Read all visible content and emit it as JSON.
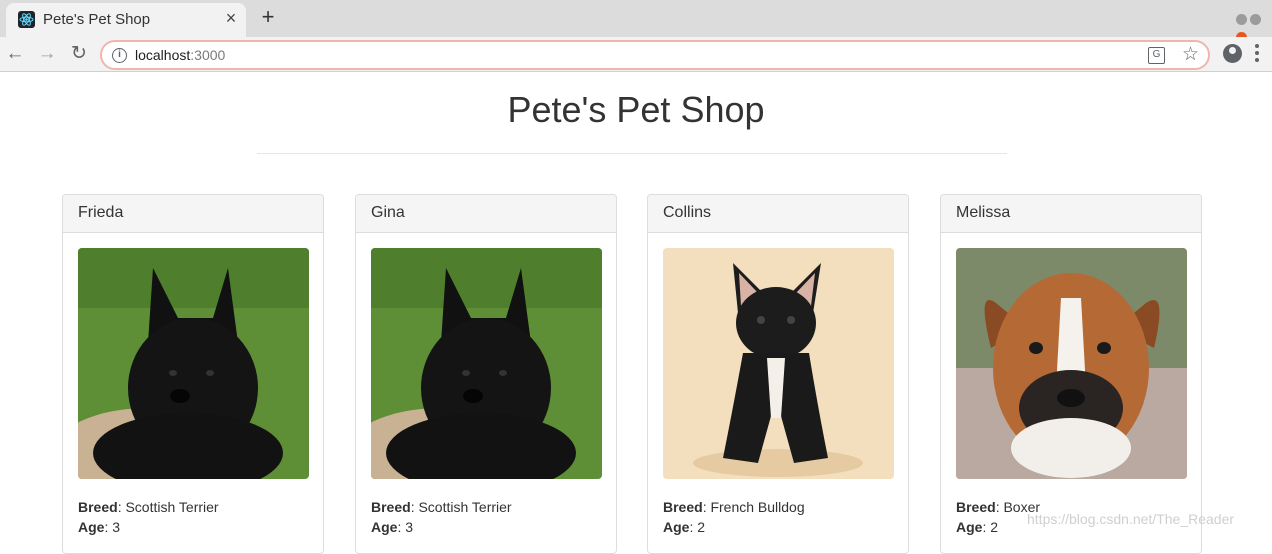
{
  "browser": {
    "tab_title": "Pete's Pet Shop",
    "tab_close": "×",
    "new_tab": "+",
    "url_host": "localhost",
    "url_port": ":3000"
  },
  "page": {
    "title": "Pete's Pet Shop"
  },
  "pets": [
    {
      "name": "Frieda",
      "breed_label": "Breed",
      "breed": ": Scottish Terrier",
      "age_label": "Age",
      "age": ": 3"
    },
    {
      "name": "Gina",
      "breed_label": "Breed",
      "breed": ": Scottish Terrier",
      "age_label": "Age",
      "age": ": 3"
    },
    {
      "name": "Collins",
      "breed_label": "Breed",
      "breed": ": French Bulldog",
      "age_label": "Age",
      "age": ": 2"
    },
    {
      "name": "Melissa",
      "breed_label": "Breed",
      "breed": ": Boxer",
      "age_label": "Age",
      "age": ": 2"
    }
  ],
  "watermark": "https://blog.csdn.net/The_Reader"
}
